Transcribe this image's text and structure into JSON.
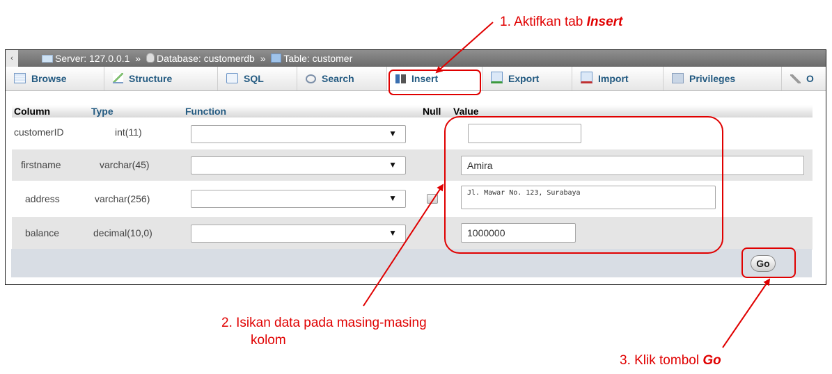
{
  "annotations": {
    "step1_prefix": "1.  Aktifkan tab ",
    "step1_emph": "Insert",
    "step2_line1": "2.  Isikan data pada masing-masing",
    "step2_line2": "kolom",
    "step3_prefix": "3.  Klik tombol ",
    "step3_emph": "Go"
  },
  "breadcrumb": {
    "collapse": "‹",
    "server": "Server: 127.0.0.1",
    "database": "Database: customerdb",
    "table": "Table: customer",
    "separator": "»"
  },
  "tabs": [
    {
      "label": "Browse",
      "icon": "browse-icon"
    },
    {
      "label": "Structure",
      "icon": "structure-icon"
    },
    {
      "label": "SQL",
      "icon": "sql-icon"
    },
    {
      "label": "Search",
      "icon": "search-icon"
    },
    {
      "label": "Insert",
      "icon": "insert-icon",
      "active": true
    },
    {
      "label": "Export",
      "icon": "export-icon"
    },
    {
      "label": "Import",
      "icon": "import-icon"
    },
    {
      "label": "Privileges",
      "icon": "privileges-icon"
    },
    {
      "label": "O",
      "icon": "wrench-icon"
    }
  ],
  "table_headers": {
    "column": "Column",
    "type": "Type",
    "function": "Function",
    "null": "Null",
    "value": "Value"
  },
  "rows": [
    {
      "column": "customerID",
      "type": "int(11)",
      "function": "",
      "value": ""
    },
    {
      "column": "firstname",
      "type": "varchar(45)",
      "function": "",
      "value": "Amira"
    },
    {
      "column": "address",
      "type": "varchar(256)",
      "function": "",
      "value": "Jl. Mawar No. 123, Surabaya"
    },
    {
      "column": "balance",
      "type": "decimal(10,0)",
      "function": "",
      "value": "1000000"
    }
  ],
  "go_button": "Go",
  "colors": {
    "annotation_red": "#e00000",
    "tab_text": "#235a81"
  }
}
